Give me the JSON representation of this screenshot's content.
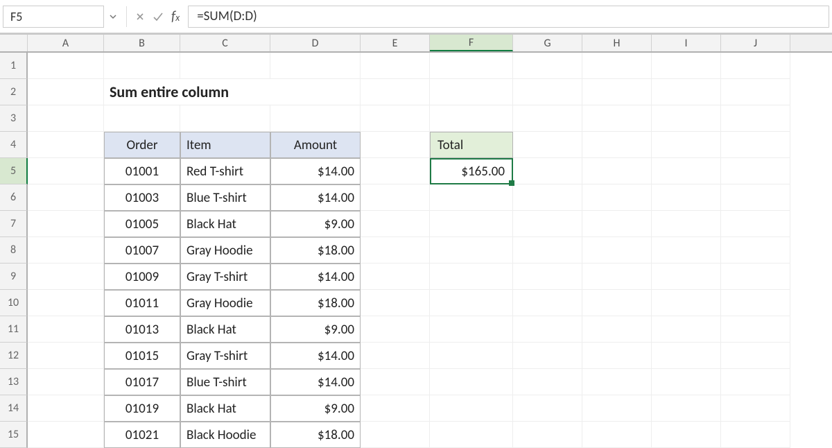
{
  "formula_bar": {
    "cell_ref": "F5",
    "formula": "=SUM(D:D)"
  },
  "columns": [
    "A",
    "B",
    "C",
    "D",
    "E",
    "F",
    "G",
    "H",
    "I",
    "J"
  ],
  "selected_col": "F",
  "selected_row": 5,
  "title": "Sum entire column",
  "table": {
    "headers": {
      "order": "Order",
      "item": "Item",
      "amount": "Amount"
    },
    "rows": [
      {
        "order": "01001",
        "item": "Red T-shirt",
        "amount": "$14.00"
      },
      {
        "order": "01003",
        "item": "Blue T-shirt",
        "amount": "$14.00"
      },
      {
        "order": "01005",
        "item": "Black Hat",
        "amount": "$9.00"
      },
      {
        "order": "01007",
        "item": "Gray Hoodie",
        "amount": "$18.00"
      },
      {
        "order": "01009",
        "item": "Gray T-shirt",
        "amount": "$14.00"
      },
      {
        "order": "01011",
        "item": "Gray Hoodie",
        "amount": "$18.00"
      },
      {
        "order": "01013",
        "item": "Black Hat",
        "amount": "$9.00"
      },
      {
        "order": "01015",
        "item": "Gray T-shirt",
        "amount": "$14.00"
      },
      {
        "order": "01017",
        "item": "Blue T-shirt",
        "amount": "$14.00"
      },
      {
        "order": "01019",
        "item": "Black Hat",
        "amount": "$9.00"
      },
      {
        "order": "01021",
        "item": "Black Hoodie",
        "amount": "$18.00"
      }
    ]
  },
  "total": {
    "label": "Total",
    "value": "$165.00"
  },
  "row_numbers": [
    1,
    2,
    3,
    4,
    5,
    6,
    7,
    8,
    9,
    10,
    11,
    12,
    13,
    14,
    15
  ]
}
